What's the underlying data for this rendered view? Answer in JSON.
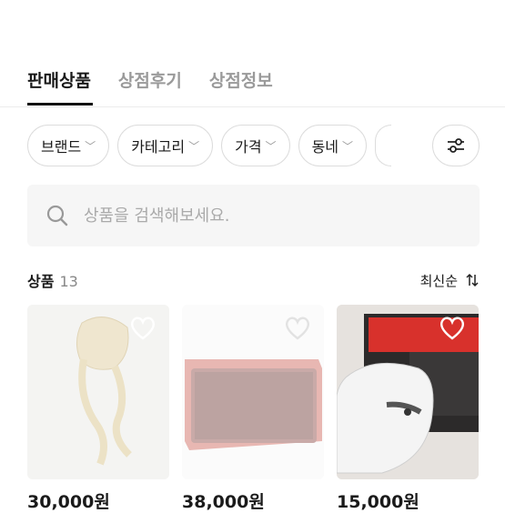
{
  "tabs": [
    "판매상품",
    "상점후기",
    "상점정보"
  ],
  "filters": [
    "브랜드",
    "카테고리",
    "가격",
    "동네"
  ],
  "search": {
    "placeholder": "상품을 검색해보세요."
  },
  "products_header": {
    "label": "상품",
    "count": "13",
    "sort": "최신순"
  },
  "products": [
    {
      "price": "30,000원"
    },
    {
      "price": "38,000원"
    },
    {
      "price": "15,000원"
    }
  ]
}
